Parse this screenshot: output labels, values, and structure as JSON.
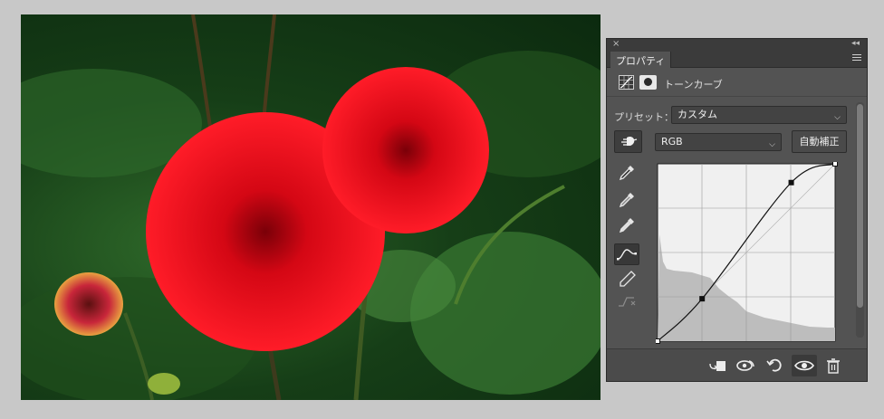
{
  "panel": {
    "tab_label": "プロパティ",
    "adjustment_type": "トーンカーブ",
    "preset_label": "プリセット：",
    "preset_value": "カスタム",
    "channel_value": "RGB",
    "auto_button": "自動補正"
  },
  "curve": {
    "control_points": [
      [
        0,
        0
      ],
      [
        64,
        61
      ],
      [
        192,
        228
      ],
      [
        255,
        255
      ]
    ],
    "grid_divisions": 4
  },
  "colors": {
    "panel_bg": "#535353",
    "curve_bg": "#f0f0f0",
    "histogram": "#bdbdbd",
    "flower_red": "#e30d1a"
  }
}
